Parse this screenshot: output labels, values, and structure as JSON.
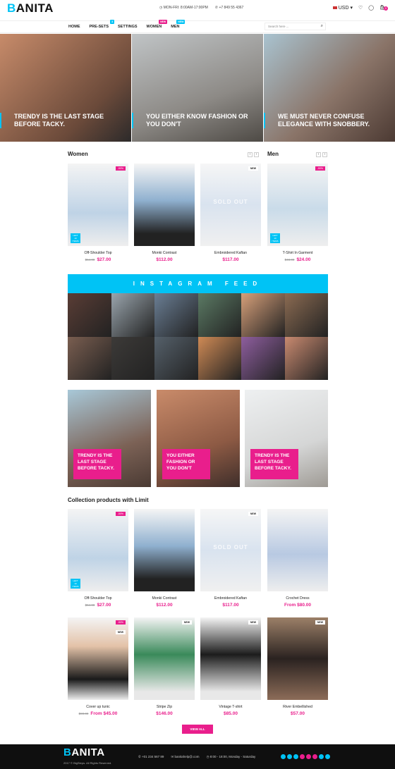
{
  "header": {
    "logo_first": "B",
    "logo_rest": "ANITA",
    "hours": "MON-FRI: 8:00AM-17:00PM",
    "phone": "+7 849 55 4367",
    "currency": "USD",
    "cart_count": "0"
  },
  "nav": {
    "items": [
      "HOME",
      "PRE-SETS",
      "SETTINGS",
      "WOMEN",
      "MEN"
    ],
    "tags": {
      "presets": "3",
      "women": "NEW",
      "men": "NEW"
    },
    "search_placeholder": "Search here ..."
  },
  "hero": [
    {
      "caption": "TRENDY IS THE LAST STAGE BEFORE TACKY."
    },
    {
      "caption": "YOU EITHER KNOW FASHION OR YOU DON'T"
    },
    {
      "caption": "WE MUST NEVER CONFUSE ELEGANCE WITH SNOBBERY."
    }
  ],
  "sections": {
    "women": "Women",
    "men": "Men",
    "collection": "Collection products with Limit"
  },
  "row1": [
    {
      "name": "Off-Shoulder Top",
      "old": "$54.00",
      "price": "$27.00",
      "badge": "-50%",
      "left": "LEFT 10 ITEMS"
    },
    {
      "name": "Monki Contrast",
      "old": "",
      "price": "$112.00",
      "badge": "",
      "left": ""
    },
    {
      "name": "Embroidered Kaftan",
      "old": "",
      "price": "$117.00",
      "badge": "NEW",
      "left": "",
      "soldout": "SOLD OUT"
    },
    {
      "name": "T-Shirt In Garment",
      "old": "$48.00",
      "price": "$24.00",
      "badge": "-50%",
      "left": "LEFT 10 ITEMS"
    }
  ],
  "instagram": {
    "title": "INSTAGRAM FEED",
    "tiles": [
      "#5a3d35",
      "#9aa5ad",
      "#6a7e94",
      "#5b7a64",
      "#d7a07a",
      "#8b6b52",
      "#7a5e50",
      "#3c3a38",
      "#55606a",
      "#cf8a55",
      "#8e5e9e",
      "#c98a70"
    ]
  },
  "banners": [
    {
      "text": "TRENDY IS THE LAST STAGE BEFORE TACKY."
    },
    {
      "text": "YOU EITHER FASHION OR YOU DON'T"
    },
    {
      "text": "TRENDY IS THE LAST STAGE BEFORE TACKY."
    }
  ],
  "row2": [
    {
      "name": "Off-Shoulder Top",
      "old": "$54.00",
      "price": "$27.00",
      "badge": "-50%",
      "left": "LEFT 10 ITEMS"
    },
    {
      "name": "Monki Contrast",
      "old": "",
      "price": "$112.00",
      "badge": "",
      "left": ""
    },
    {
      "name": "Embroidered Kaftan",
      "old": "",
      "price": "$117.00",
      "badge": "NEW",
      "left": "",
      "soldout": "SOLD OUT"
    },
    {
      "name": "Crochet Dress",
      "old": "",
      "price": "From $80.00",
      "badge": "",
      "left": ""
    }
  ],
  "row3": [
    {
      "name": "Cover up tunic",
      "old": "$90.00",
      "price": "From $45.00",
      "badge": "-50%",
      "badge2": "NEW"
    },
    {
      "name": "Stripe Zip",
      "old": "",
      "price": "$146.00",
      "badge": "NEW"
    },
    {
      "name": "Vintage T-shirt",
      "old": "",
      "price": "$85.00",
      "badge": "NEW"
    },
    {
      "name": "River Embellished",
      "old": "",
      "price": "$57.00",
      "badge": "NEW"
    }
  ],
  "view_all": "VIEW ALL",
  "footer": {
    "logo_first": "B",
    "logo_rest": "ANITA",
    "copyright": "2017 © BigSteps. All Rights Reserved.",
    "phone": "+01 234 567 89",
    "email": "banitahelp@.com",
    "hours": "8:00 - 18:00, Monday - Saturday"
  }
}
